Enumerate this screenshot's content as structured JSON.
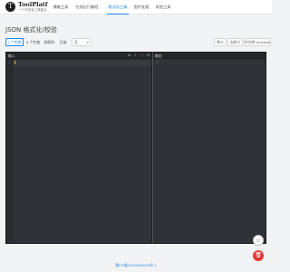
{
  "header": {
    "logo_glyph": "T",
    "brand": "ToolPlatf",
    "tagline": "一个开发者工具集合",
    "nav": [
      {
        "label": "爆破工具",
        "active": false
      },
      {
        "label": "在线运行编程",
        "active": false
      },
      {
        "label": "格式化工具",
        "active": true
      },
      {
        "label": "图片处理",
        "active": false
      },
      {
        "label": "其他工具",
        "active": false
      }
    ]
  },
  "page": {
    "title": "JSON 格式化/校验"
  },
  "toolbar": {
    "left_buttons": [
      "2 个空格",
      "4 个空格",
      "制表符",
      "压缩"
    ],
    "select_value": "无",
    "right_buttons": [
      "转义",
      "去转义",
      "中文转 Unicode"
    ]
  },
  "editor": {
    "input_title": "输入",
    "output_title": "输出",
    "input_icons": [
      "copy-icon",
      "download-icon",
      "delete-icon",
      "settings-icon"
    ],
    "line_number": "1",
    "output_marker": "1"
  },
  "footer": {
    "text": "蜀ICP备2023005010号-1"
  },
  "colors": {
    "accent": "#1e88e5",
    "editor_bg": "#2f3236",
    "danger": "#e53935"
  }
}
